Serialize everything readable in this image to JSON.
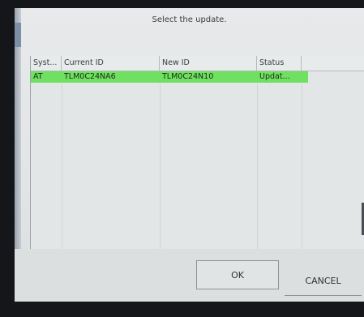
{
  "dialog": {
    "title": "Select the update."
  },
  "table": {
    "columns": [
      "Syst...",
      "Current ID",
      "New ID",
      "Status"
    ],
    "rows": [
      {
        "system": "AT",
        "current_id": "TLM0C24NA6",
        "new_id": "TLM0C24N10",
        "status": "Updat...",
        "highlight_color": "#6fe060"
      }
    ]
  },
  "buttons": {
    "ok_label": "OK",
    "cancel_label": "CANCEL"
  }
}
